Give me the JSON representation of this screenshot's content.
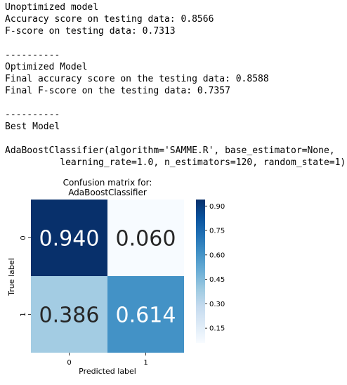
{
  "output_lines": [
    "Unoptimized model",
    "Accuracy score on testing data: 0.8566",
    "F-score on testing data: 0.7313",
    "",
    "----------",
    "Optimized Model",
    "Final accuracy score on the testing data: 0.8588",
    "Final F-score on the testing data: 0.7357",
    "",
    "----------",
    "Best Model",
    "",
    "AdaBoostClassifier(algorithm='SAMME.R', base_estimator=None,",
    "          learning_rate=1.0, n_estimators=120, random_state=1)"
  ],
  "chart_data": {
    "type": "heatmap",
    "title": [
      "Confusion matrix for:",
      "AdaBoostClassifier"
    ],
    "xlabel": "Predicted label",
    "ylabel": "True label",
    "x_categories": [
      "0",
      "1"
    ],
    "y_categories": [
      "0",
      "1"
    ],
    "values": [
      [
        0.94,
        0.06
      ],
      [
        0.386,
        0.614
      ]
    ],
    "cell_labels": [
      [
        "0.940",
        "0.060"
      ],
      [
        "0.386",
        "0.614"
      ]
    ],
    "colormap": "Blues",
    "colorbar": {
      "ticks": [
        0.9,
        0.75,
        0.6,
        0.45,
        0.3,
        0.15
      ],
      "tick_labels": [
        "0.90",
        "0.75",
        "0.60",
        "0.45",
        "0.30",
        "0.15"
      ],
      "vmin": 0.06,
      "vmax": 0.94
    },
    "cell_colors": [
      [
        "#08306b",
        "#f7fbff"
      ],
      [
        "#a3cce3",
        "#4392c6"
      ]
    ],
    "colors": {
      "dark_text": "#262626",
      "light_text": "#ffffff",
      "bar_low": "#f7fbff",
      "bar_high": "#08306b"
    }
  }
}
